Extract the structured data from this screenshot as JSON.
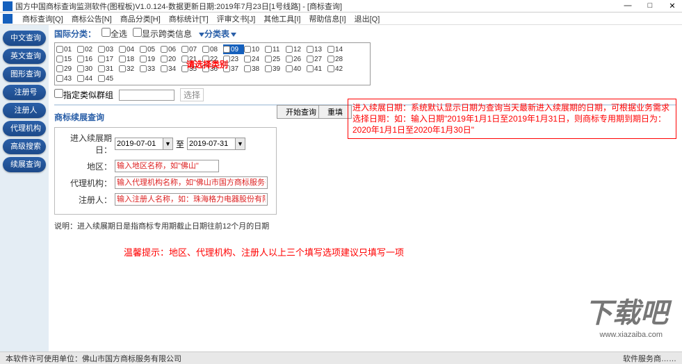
{
  "titlebar": {
    "text": "国方中国商标查询监测软件(图程板)V1.0.124-数据更新日期:2019年7月23日[1号线路] - [商标查询]"
  },
  "menubar": {
    "items": [
      "商标查询[Q]",
      "商标公告[N]",
      "商品分类[H]",
      "商标统计[T]",
      "评审文书[J]",
      "其他工具[I]",
      "帮助信息[I]",
      "退出[Q]"
    ]
  },
  "sidebar": {
    "items": [
      "中文查询",
      "英文查询",
      "图形查询",
      "注册号",
      "注册人",
      "代理机构",
      "高级搜索",
      "续展查询"
    ]
  },
  "classify": {
    "label": "国际分类：",
    "select_all": "全选",
    "show_cross": "显示跨类信息",
    "table_btn": "分类表",
    "numbers": [
      "01",
      "02",
      "03",
      "04",
      "05",
      "06",
      "07",
      "08",
      "09",
      "10",
      "11",
      "12",
      "13",
      "14",
      "15",
      "16",
      "17",
      "18",
      "19",
      "20",
      "21",
      "22",
      "23",
      "24",
      "25",
      "26",
      "27",
      "28",
      "29",
      "30",
      "31",
      "32",
      "33",
      "34",
      "35",
      "36",
      "37",
      "38",
      "39",
      "40",
      "41",
      "42",
      "43",
      "44",
      "45"
    ],
    "overlay": "请选择类别",
    "similar_group": "指定类似群组",
    "select_label": "选择"
  },
  "form": {
    "section_title": "商标续展查询",
    "date_label": "进入续展期日：",
    "date_from": "2019-07-01",
    "date_sep": "至",
    "date_to": "2019-07-31",
    "search_btn": "开始查询",
    "reset_btn": "重填",
    "region_label": "地区：",
    "region_placeholder": "输入地区名称，如\"佛山\"",
    "agency_label": "代理机构：",
    "agency_placeholder": "输入代理机构名称，如\"佛山市国方商标服务有限公司\"",
    "registrant_label": "注册人：",
    "registrant_placeholder": "输入注册人名称，如：珠海格力电器股份有限公司"
  },
  "note": "说明：进入续展期日是指商标专用期截止日期往前12个月的日期",
  "tip": "温馨提示：地区、代理机构、注册人以上三个填写选项建议只填写一项",
  "info_box": "进入续展日期：系统默认显示日期为查询当天最新进入续展期的日期，可根据业务需求选择日期：如：输入日期\"2019年1月1日至2019年1月31日，则商标专用期到期日为：2020年1月1日至2020年1月30日\"",
  "statusbar": {
    "left": "本软件许可使用单位：佛山市国方商标服务有限公司",
    "right": "软件服务商……"
  },
  "watermark": {
    "text": "下载吧",
    "url": "www.xiazaiba.com"
  }
}
